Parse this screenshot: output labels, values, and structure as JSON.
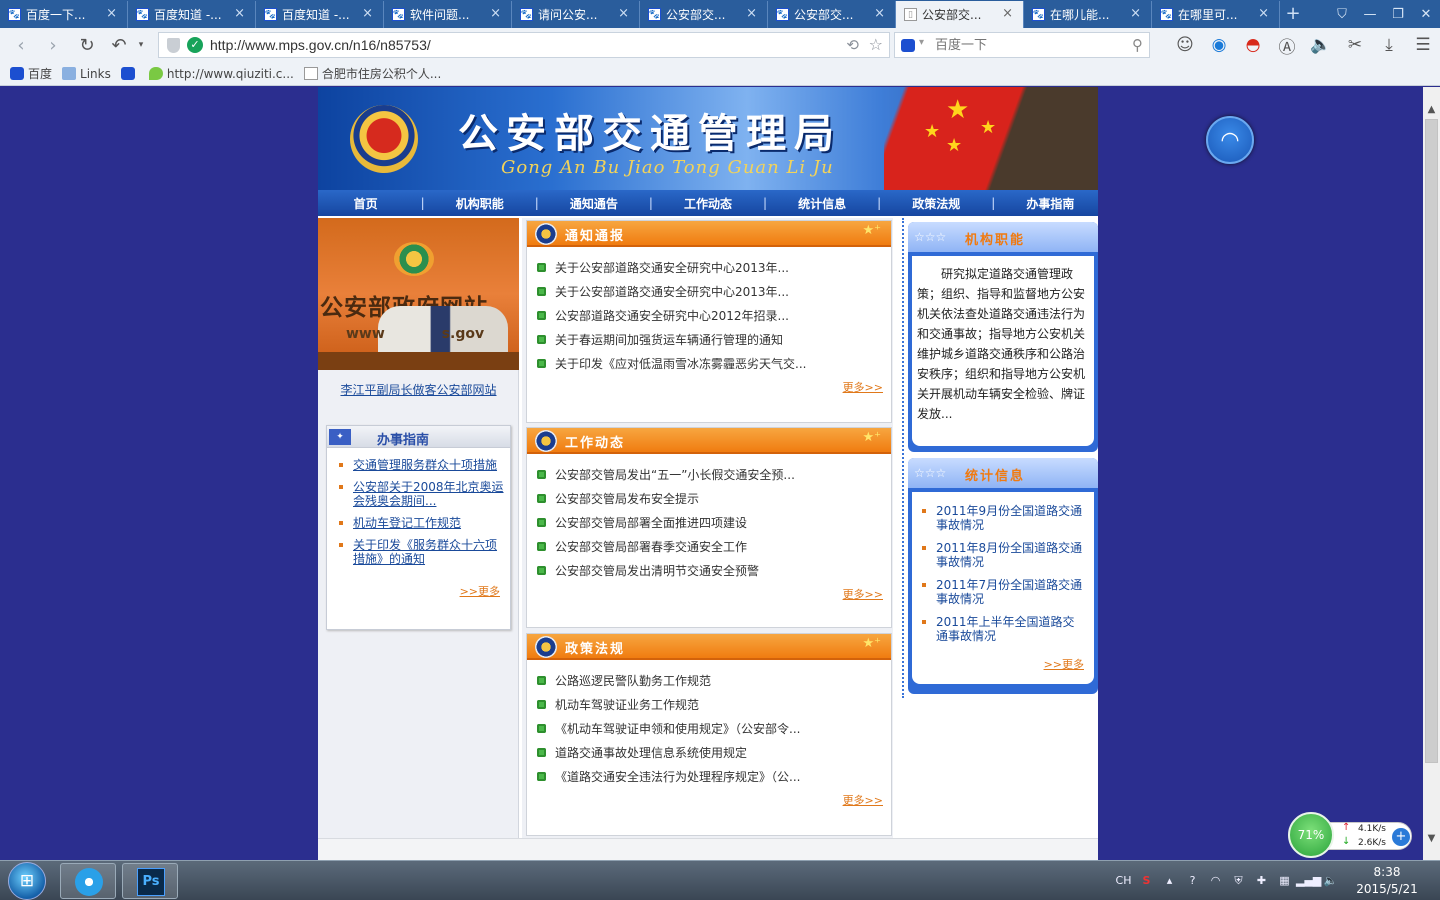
{
  "browser": {
    "tabs": [
      {
        "label": "百度一下..."
      },
      {
        "label": "百度知道 -..."
      },
      {
        "label": "百度知道 -..."
      },
      {
        "label": "软件问题..."
      },
      {
        "label": "请问公安..."
      },
      {
        "label": "公安部交..."
      },
      {
        "label": "公安部交..."
      },
      {
        "label": "公安部交..."
      },
      {
        "label": "在哪儿能..."
      },
      {
        "label": "在哪里可..."
      }
    ],
    "active_tab_index": 7,
    "url": "http://www.mps.gov.cn/n16/n85753/",
    "search_placeholder": "百度一下",
    "bookmarks": [
      {
        "label": "百度",
        "icon": "paw-icon"
      },
      {
        "label": "Links",
        "icon": "folder-icon"
      },
      {
        "label": "",
        "icon": "paw-icon"
      },
      {
        "label": "http://www.qiuziti.c...",
        "icon": "pin-icon"
      },
      {
        "label": "合肥市住房公积个人...",
        "icon": "page-icon"
      }
    ]
  },
  "site": {
    "banner": {
      "title": "公安部交通管理局",
      "pinyin": "Gong An Bu Jiao Tong Guan Li Ju"
    },
    "menu": [
      "首页",
      "机构职能",
      "通知通告",
      "工作动态",
      "统计信息",
      "政策法规",
      "办事指南"
    ],
    "photo": {
      "title": "公安部政府网站",
      "www": "www",
      "www_tail": "s.gov",
      "caption": "李江平副局长做客公安部网站"
    },
    "guide": {
      "title": "办事指南",
      "items": [
        "交通管理服务群众十项措施",
        "公安部关于2008年北京奥运会残奥会期间...",
        "机动车登记工作规范",
        "关于印发《服务群众十六项措施》的通知"
      ],
      "more": ">>更多"
    },
    "notices": {
      "title": "通知通报",
      "items": [
        "关于公安部道路交通安全研究中心2013年...",
        "关于公安部道路交通安全研究中心2013年...",
        "公安部道路交通安全研究中心2012年招录...",
        "关于春运期间加强货运车辆通行管理的通知",
        "关于印发《应对低温雨雪冰冻雾霾恶劣天气交..."
      ],
      "more": "更多>>"
    },
    "work": {
      "title": "工作动态",
      "items": [
        "公安部交管局发出“五一”小长假交通安全预...",
        "公安部交管局发布安全提示",
        "公安部交管局部署全面推进四项建设",
        "公安部交管局部署春季交通安全工作",
        "公安部交管局发出清明节交通安全预警"
      ],
      "more": "更多>>"
    },
    "policy": {
      "title": "政策法规",
      "items": [
        "公路巡逻民警队勤务工作规范",
        "机动车驾驶证业务工作规范",
        "《机动车驾驶证申领和使用规定》（公安部令...",
        "道路交通事故处理信息系统使用规定",
        "《道路交通安全违法行为处理程序规定》（公..."
      ],
      "more": "更多>>"
    },
    "functions": {
      "title": "机构职能",
      "text": "研究拟定道路交通管理政策；组织、指导和监督地方公安机关依法查处道路交通违法行为和交通事故；指导地方公安机关维护城乡道路交通秩序和公路治安秩序；组织和指导地方公安机关开展机动车辆安全检验、牌证发放..."
    },
    "stats": {
      "title": "统计信息",
      "items": [
        "2011年9月份全国道路交通事故情况",
        "2011年8月份全国道路交通事故情况",
        "2011年7月份全国道路交通事故情况",
        "2011年上半年全国道路交通事故情况"
      ],
      "more": ">>更多"
    }
  },
  "net_widget": {
    "percent": "71%",
    "up": "4.1K/s",
    "down": "2.6K/s"
  },
  "taskbar": {
    "lang": "CH",
    "time": "8:38",
    "date": "2015/5/21"
  },
  "colors": {
    "page_bg": "#2b2e8f",
    "tabbar": "#2a5d9c",
    "orange_header": "#f07c10",
    "blue_menu": "#1646a0",
    "link_blue": "#1a4a9a"
  }
}
